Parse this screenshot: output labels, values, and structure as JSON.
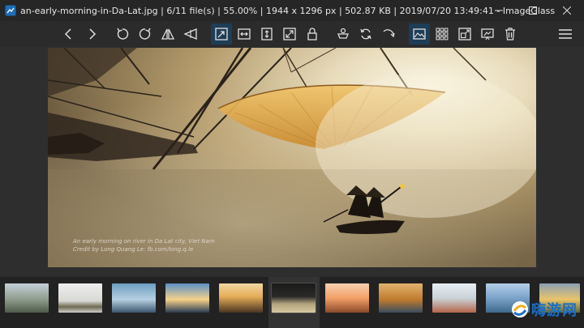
{
  "window": {
    "title": "an-early-morning-in-Da-Lat.jpg  |  6/11 file(s)  |  55.00%  |  1944 x 1296 px  |  502.87 KB  |  2019/07/20 13:49:41  - ImageGlass",
    "minimize_icon": "minimize-icon",
    "maximize_icon": "maximize-icon",
    "close_icon": "close-icon"
  },
  "toolbar": {
    "icons": [
      "chevron-left-icon",
      "chevron-right-icon",
      "rotate-left-icon",
      "rotate-right-icon",
      "flip-horizontal-icon",
      "flip-vertical-icon",
      "actual-size-icon",
      "fit-width-icon",
      "fit-height-icon",
      "auto-zoom-icon",
      "lock-zoom-icon",
      "color-picker-icon",
      "slideshow-icon",
      "open-with-icon",
      "image-icon",
      "thumbnail-grid-icon",
      "full-screen-icon",
      "frameless-icon",
      "delete-icon",
      "menu-icon"
    ]
  },
  "photo": {
    "caption_line1": "An early morning on river in Da Lat city, Viet Nam",
    "caption_line2": "Credit by Long Quang Le: fb.com/long.q.le"
  },
  "thumbnails": {
    "count": 11,
    "current_index": 5
  },
  "watermark": {
    "text": "嗨游网"
  },
  "colors": {
    "titlebar_bg": "#262626",
    "toolbar_bg": "#2b2b2b",
    "active_tool_bg": "#1e3d56",
    "thumbstrip_bg": "#222222",
    "accent": "#1a6ec7"
  }
}
